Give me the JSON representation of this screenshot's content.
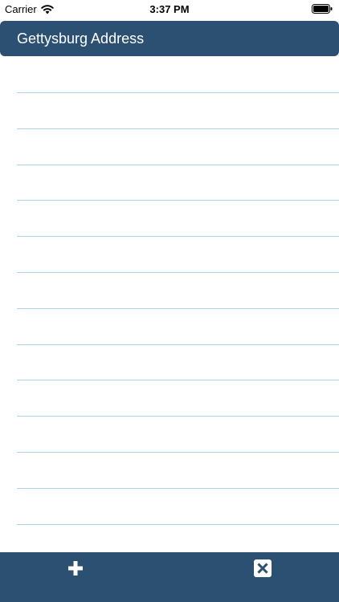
{
  "status_bar": {
    "carrier": "Carrier",
    "time": "3:37 PM",
    "icons": [
      "wifi-icon",
      "battery-icon"
    ]
  },
  "header": {
    "title": "Gettysburg Address"
  },
  "notes": {
    "line_count": 13,
    "line_color": "#a8d4e6"
  },
  "toolbar": {
    "buttons": [
      {
        "name": "add",
        "icon": "plus-icon"
      },
      {
        "name": "delete",
        "icon": "close-box-icon"
      }
    ]
  },
  "colors": {
    "accent": "#2b5072",
    "icon": "#ffffff",
    "background": "#ffffff"
  }
}
